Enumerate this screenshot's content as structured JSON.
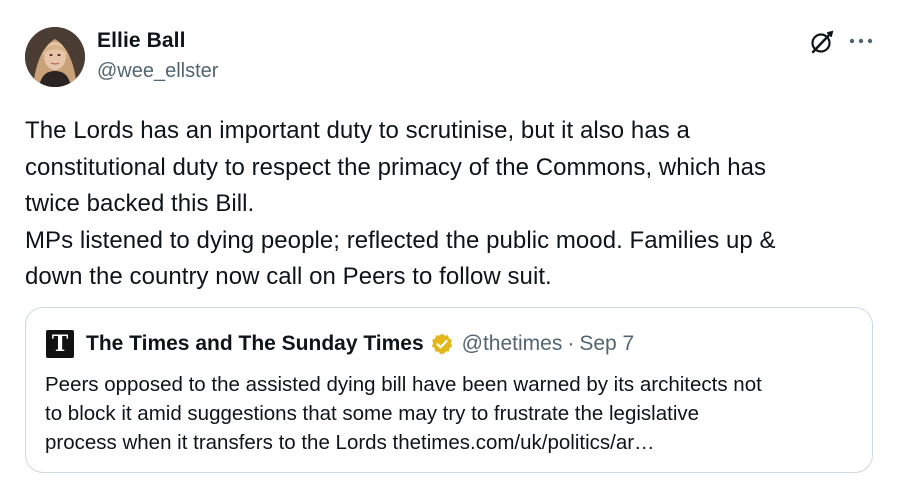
{
  "author": {
    "name": "Ellie Ball",
    "handle": "@wee_ellster"
  },
  "header_icons": [
    "grok-icon",
    "more-icon"
  ],
  "tweet": {
    "lines": [
      "The Lords has an important duty to scrutinise, but it also has a",
      "constitutional duty to respect the primacy of the Commons, which has",
      "twice backed this Bill.",
      "MPs listened to dying people; reflected the public mood. Families up &",
      "down the country now call on Peers to follow suit."
    ]
  },
  "quote": {
    "logo_letter": "T",
    "name": "The Times and The Sunday Times",
    "handle": "@thetimes",
    "separator": "·",
    "date": "Sep 7",
    "verified_color": "#e2b719",
    "lines": [
      "Peers opposed to the assisted dying bill have been warned by its architects not",
      "to block it amid suggestions that some may try to frustrate the legislative",
      "process when it transfers to the Lords thetimes.com/uk/politics/ar…"
    ]
  }
}
